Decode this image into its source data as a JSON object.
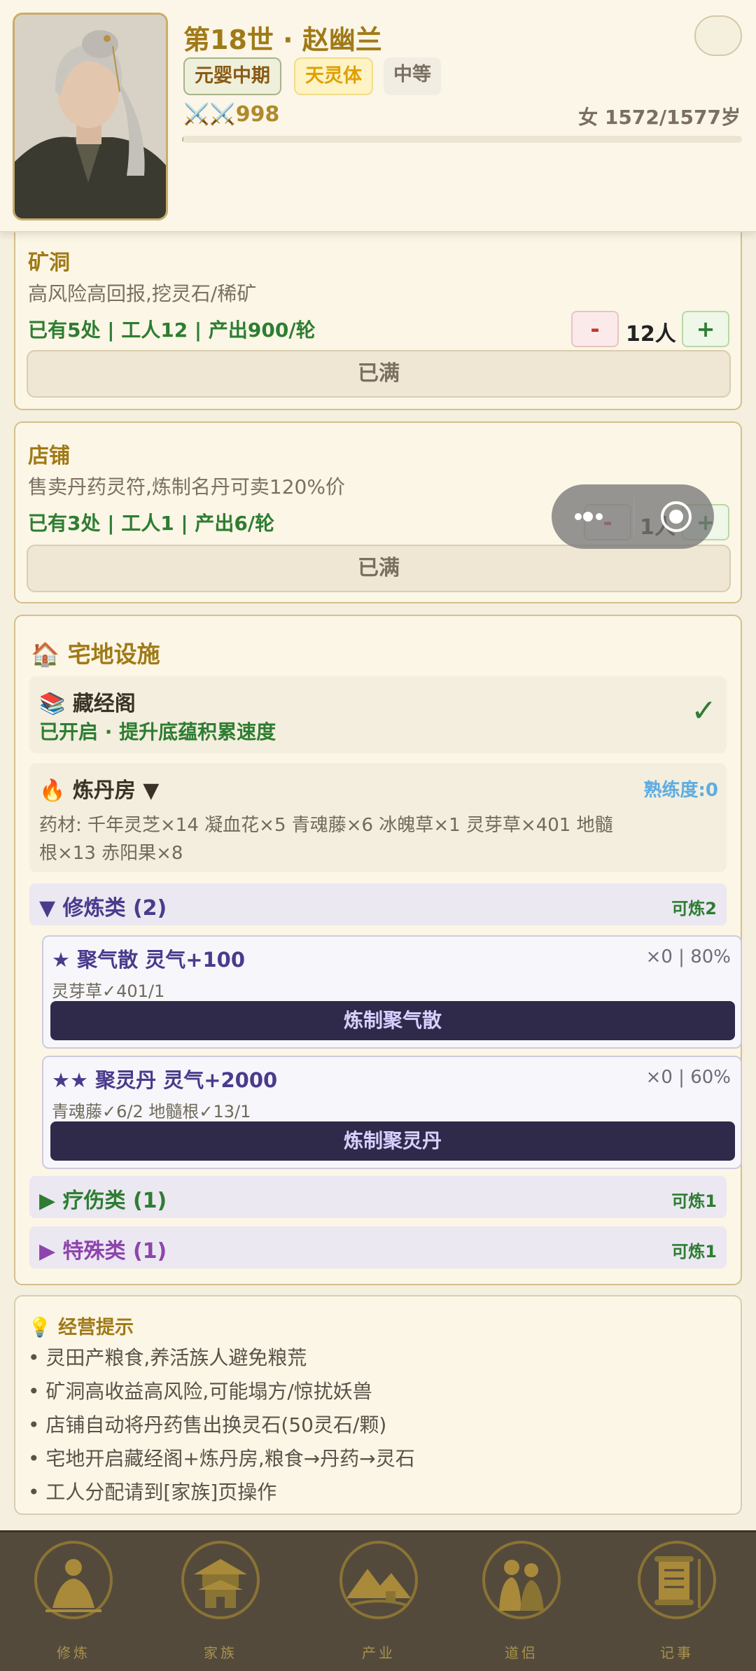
{
  "header": {
    "name": "第18世 · 赵幽兰",
    "info_icon": "",
    "realm": "元婴中期",
    "body": "天灵体",
    "grade": "中等",
    "power": "998",
    "age": "女 1572/1577岁",
    "lifespan_fraction": 0.002
  },
  "mine": {
    "title": "矿洞",
    "desc": "高风险高回报,挖灵石/稀矿",
    "stats": "已有5处 | 工人12 | 产出900/轮",
    "minus": "-",
    "count": "12人",
    "plus": "+",
    "full": "已满"
  },
  "shop": {
    "title": "店铺",
    "desc": "售卖丹药灵符,炼制名丹可卖120%价",
    "stats": "已有3处 | 工人1 | 产出6/轮",
    "minus": "-",
    "count": "1人",
    "plus": "+",
    "full": "已满"
  },
  "residence": {
    "title": "宅地设施",
    "library": {
      "name": "藏经阁",
      "status": "已开启 · 提升底蕴积累速度",
      "check": "✓"
    },
    "alchemy": {
      "name": "炼丹房 ▼",
      "proficiency": "熟练度:0",
      "materials_line1": "药材: 千年灵芝×14 凝血花×5 青魂藤×6 冰魄草×1 灵芽草×401 地髓",
      "materials_line2": "根×13 赤阳果×8"
    },
    "categories": [
      {
        "label": "▼ 修炼类 (2)",
        "right": "可炼2",
        "color": "#4a3b8c"
      },
      {
        "label": "▶ 疗伤类 (1)",
        "right": "可炼1",
        "color": "#2e7d32"
      },
      {
        "label": "▶ 特殊类 (1)",
        "right": "可炼1",
        "color": "#8e44ad"
      }
    ],
    "recipes": [
      {
        "name": "★ 聚气散 灵气+100",
        "stat": "×0 | 80%",
        "mats": "灵芽草✓401/1",
        "button": "炼制聚气散"
      },
      {
        "name": "★★ 聚灵丹 灵气+2000",
        "stat": "×0 | 60%",
        "mats": "青魂藤✓6/2  地髓根✓13/1",
        "button": "炼制聚灵丹"
      }
    ]
  },
  "tips": {
    "title": "经营提示",
    "lines": [
      "•  灵田产粮食,养活族人避免粮荒",
      "•  矿洞高收益高风险,可能塌方/惊扰妖兽",
      "•  店铺自动将丹药售出换灵石(50灵石/颗)",
      "•  宅地开启藏经阁+炼丹房,粮食→丹药→灵石",
      "•  工人分配请到[家族]页操作"
    ]
  },
  "nav": [
    {
      "label": "修炼"
    },
    {
      "label": "家族"
    },
    {
      "label": "产业"
    },
    {
      "label": "道侣"
    },
    {
      "label": "记事"
    }
  ],
  "colors": {
    "gold": "#a07a17",
    "green": "#2e7d32",
    "purple": "#4a3b8c",
    "nav_bg": "#544a3c"
  }
}
